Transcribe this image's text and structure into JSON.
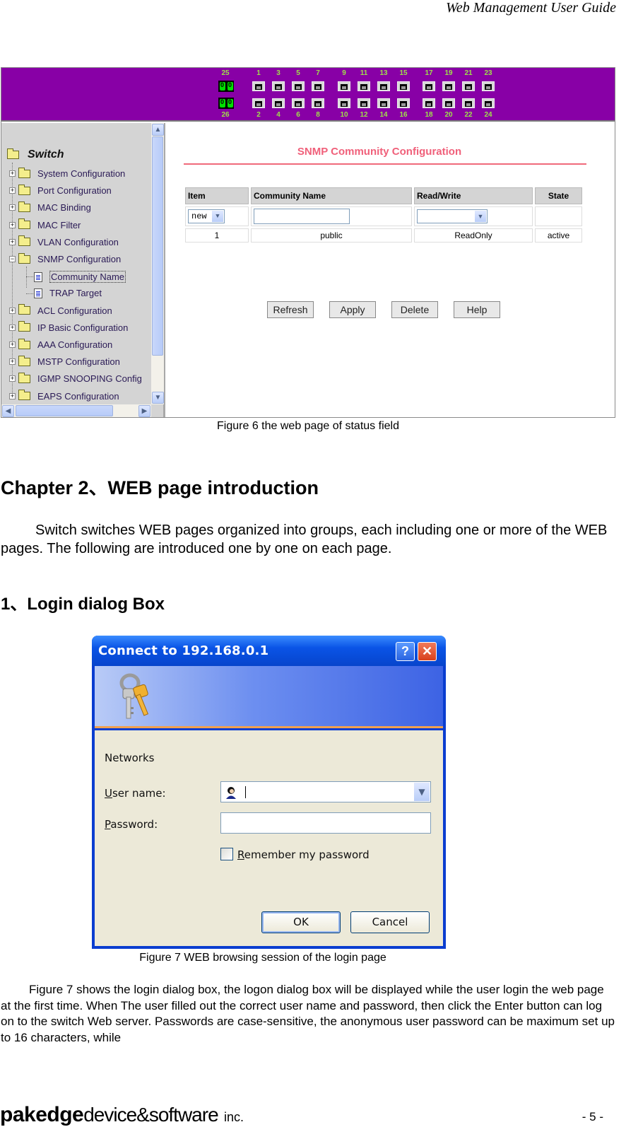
{
  "header": {
    "title": "Web Management User Guide"
  },
  "figure6": {
    "banner": {
      "color": "#8800a6",
      "fiber_ports": {
        "top": "25",
        "bottom": "26"
      },
      "port_groups": [
        {
          "top": [
            "1",
            "3",
            "5",
            "7"
          ],
          "bottom": [
            "2",
            "4",
            "6",
            "8"
          ]
        },
        {
          "top": [
            "9",
            "11",
            "13",
            "15"
          ],
          "bottom": [
            "10",
            "12",
            "14",
            "16"
          ]
        },
        {
          "top": [
            "17",
            "19",
            "21",
            "23"
          ],
          "bottom": [
            "18",
            "20",
            "22",
            "24"
          ]
        }
      ]
    },
    "tree": {
      "root": "Switch",
      "items": [
        {
          "label": "System Configuration",
          "expander": "+"
        },
        {
          "label": "Port Configuration",
          "expander": "+"
        },
        {
          "label": "MAC Binding",
          "expander": "+"
        },
        {
          "label": "MAC Filter",
          "expander": "+"
        },
        {
          "label": "VLAN Configuration",
          "expander": "+"
        },
        {
          "label": "SNMP Configuration",
          "expander": "−"
        },
        {
          "label": "ACL Configuration",
          "expander": "+"
        },
        {
          "label": "IP Basic Configuration",
          "expander": "+"
        },
        {
          "label": "AAA Configuration",
          "expander": "+"
        },
        {
          "label": "MSTP Configuration",
          "expander": "+"
        },
        {
          "label": "IGMP SNOOPING Config",
          "expander": "+"
        },
        {
          "label": "EAPS Configuration",
          "expander": "+"
        }
      ],
      "snmp_children": [
        {
          "label": "Community Name",
          "selected": true
        },
        {
          "label": "TRAP Target",
          "selected": false
        }
      ],
      "scroll_icons": {
        "up": "▲",
        "down": "▼",
        "left": "◀",
        "right": "▶"
      }
    },
    "content": {
      "title": "SNMP Community Configuration",
      "title_color": "#f0607a",
      "columns": [
        "Item",
        "Community Name",
        "Read/Write",
        "State"
      ],
      "new_row": {
        "item_select": "new",
        "community_name": "",
        "read_write": "",
        "state": ""
      },
      "rows": [
        {
          "item": "1",
          "community_name": "public",
          "read_write": "ReadOnly",
          "state": "active"
        }
      ],
      "buttons": [
        "Refresh",
        "Apply",
        "Delete",
        "Help"
      ]
    },
    "caption": "Figure 6 the web page of status field"
  },
  "chapter": {
    "title": "Chapter 2、WEB page introduction",
    "intro": "Switch switches WEB pages organized into groups, each including one or more of the WEB pages. The following are introduced one by one on each page."
  },
  "section1": {
    "title": "1、Login dialog Box"
  },
  "figure7": {
    "dialog": {
      "title": "Connect to 192.168.0.1",
      "help_button": "?",
      "close_button": "✕",
      "realm": "Networks",
      "user_label": "User name:",
      "user_accesskey": "U",
      "user_rest": "ser name:",
      "user_value": "",
      "password_label_key": "P",
      "password_rest": "assword:",
      "password_value": "",
      "remember_key": "R",
      "remember_rest": "emember my password",
      "remember_checked": false,
      "ok": "OK",
      "cancel": "Cancel"
    },
    "caption": "Figure 7 WEB browsing session of the login page"
  },
  "body": {
    "paragraph": "Figure 7 shows the login dialog box, the logon dialog box will be displayed while the user login the web page at the first time. When The user filled out the correct user name and password, then click the Enter button can log on to the switch Web server. Passwords are case-sensitive, the anonymous user password can be maximum set up to 16 characters, while"
  },
  "footer": {
    "logo_bold": "pakedge",
    "logo_light": "device&software",
    "logo_inc": "inc.",
    "page_number": "- 5 -"
  }
}
